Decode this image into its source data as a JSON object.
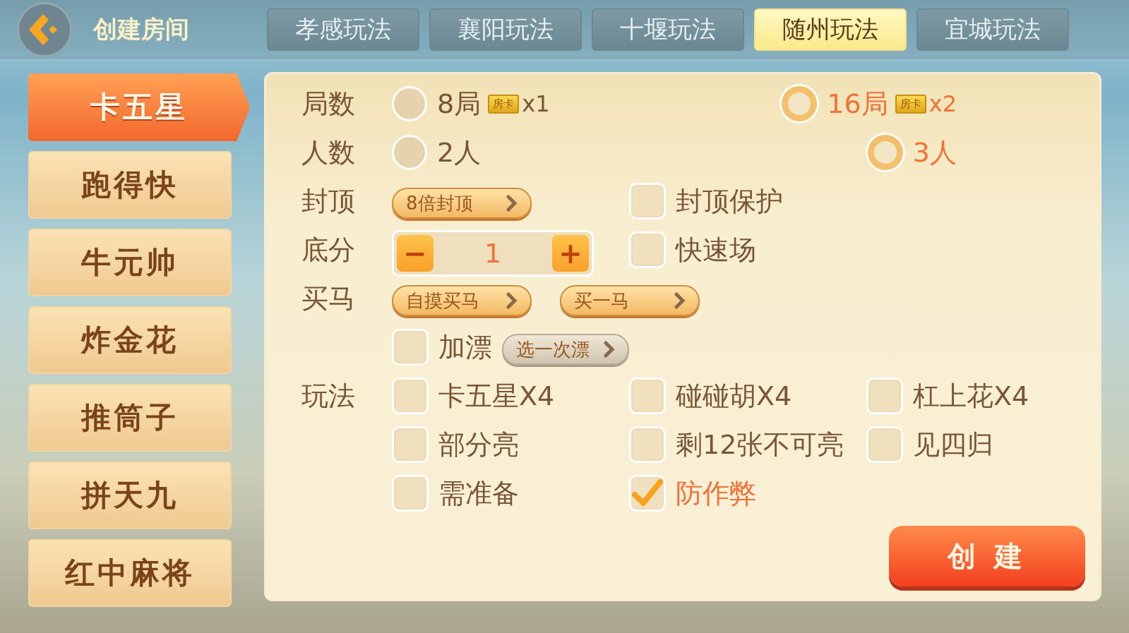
{
  "header": {
    "title": "创建房间"
  },
  "tabs": [
    {
      "label": "孝感玩法",
      "selected": false
    },
    {
      "label": "襄阳玩法",
      "selected": false
    },
    {
      "label": "十堰玩法",
      "selected": false
    },
    {
      "label": "随州玩法",
      "selected": true
    },
    {
      "label": "宜城玩法",
      "selected": false
    }
  ],
  "sidebar": {
    "items": [
      {
        "label": "卡五星",
        "selected": true
      },
      {
        "label": "跑得快",
        "selected": false
      },
      {
        "label": "牛元帅",
        "selected": false
      },
      {
        "label": "炸金花",
        "selected": false
      },
      {
        "label": "推筒子",
        "selected": false
      },
      {
        "label": "拼天九",
        "selected": false
      },
      {
        "label": "红中麻将",
        "selected": false
      }
    ]
  },
  "settings": [
    {
      "label": "局数",
      "items": [
        {
          "kind": "radio",
          "label": "8局",
          "card": "房卡",
          "multiplier": "x1",
          "selected": false
        },
        {
          "kind": "radio",
          "label": "16局",
          "card": "房卡",
          "multiplier": "x2",
          "selected": true
        }
      ]
    },
    {
      "label": "人数",
      "items": [
        {
          "kind": "radio",
          "label": "2人",
          "selected": false
        },
        {
          "kind": "radio",
          "label": "3人",
          "selected": true
        }
      ]
    },
    {
      "label": "封顶",
      "items": [
        {
          "kind": "dropdown",
          "label": "8倍封顶",
          "disabled": false
        },
        {
          "kind": "checkbox",
          "label": "封顶保护",
          "checked": false
        }
      ]
    },
    {
      "label": "底分",
      "items": [
        {
          "kind": "stepper",
          "minus": "−",
          "value": "1",
          "plus": "+"
        },
        {
          "kind": "checkbox",
          "label": "快速场",
          "checked": false
        }
      ]
    },
    {
      "label": "买马",
      "items": [
        {
          "kind": "dropdown",
          "label": "自摸买马",
          "disabled": false
        },
        {
          "kind": "dropdown",
          "label": "买一马",
          "disabled": false
        }
      ]
    },
    {
      "items": [
        {
          "kind": "checkbox",
          "label": "加漂",
          "checked": false,
          "option": {
            "label": "选一次漂",
            "disabled": true
          }
        }
      ]
    },
    {
      "label": "玩法",
      "items": [
        {
          "kind": "checkbox",
          "label": "卡五星X4",
          "checked": false
        },
        {
          "kind": "checkbox",
          "label": "碰碰胡X4",
          "checked": false
        },
        {
          "kind": "checkbox",
          "label": "杠上花X4",
          "checked": false
        },
        {
          "kind": "checkbox",
          "label": "部分亮",
          "checked": false
        },
        {
          "kind": "checkbox",
          "label": "剩12张不可亮",
          "checked": false
        },
        {
          "kind": "checkbox",
          "label": "见四归",
          "checked": false
        },
        {
          "kind": "checkbox",
          "label": "需准备",
          "checked": false
        },
        {
          "kind": "checkbox",
          "label": "防作弊",
          "checked": true
        }
      ]
    }
  ],
  "create_button": "创 建"
}
